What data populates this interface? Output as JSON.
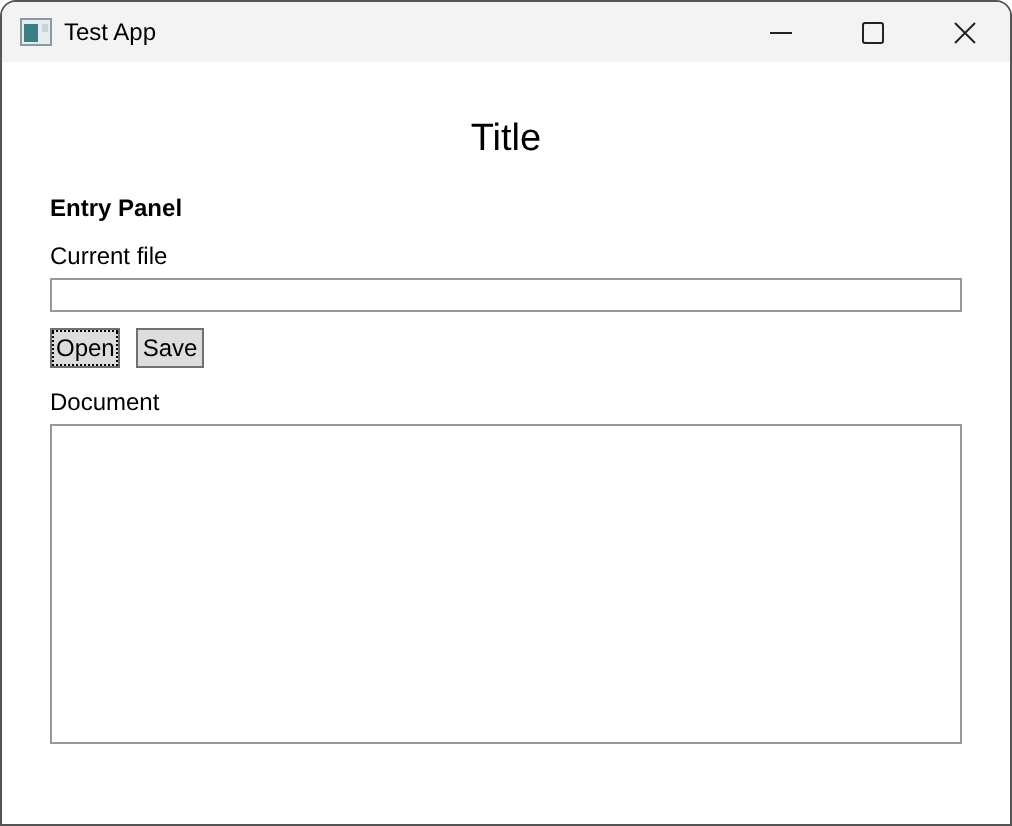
{
  "window": {
    "title": "Test App"
  },
  "heading": "Title",
  "panel": {
    "title": "Entry Panel",
    "file_label": "Current file",
    "buttons": [
      {
        "label": "Open",
        "focused": true
      },
      {
        "label": "Save",
        "focused": false
      }
    ],
    "document_label": "Document"
  }
}
